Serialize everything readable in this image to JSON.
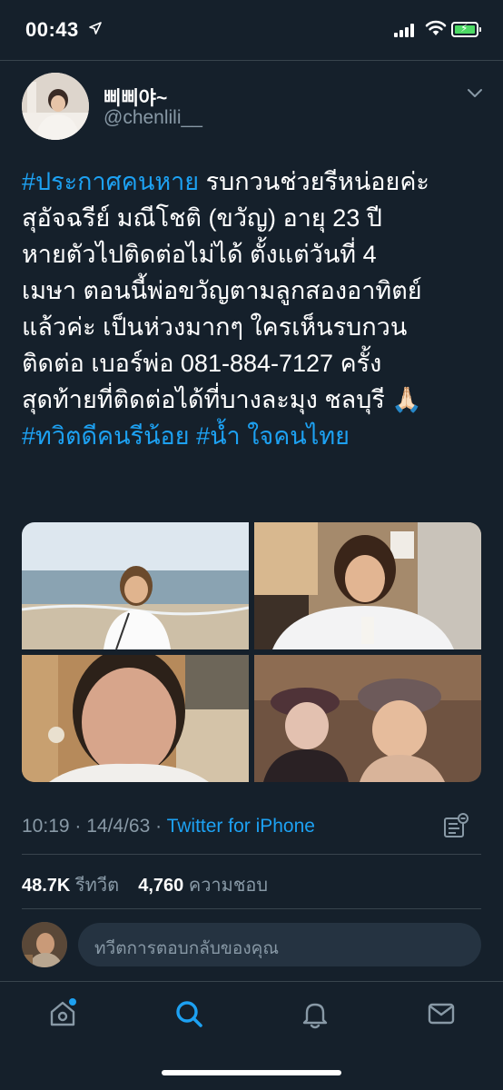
{
  "status_bar": {
    "time": "00:43",
    "location_icon": "location-arrow-icon",
    "signal_icon": "cellular-signal-icon",
    "wifi_icon": "wifi-icon",
    "battery_icon": "battery-charging-icon",
    "battery_color": "#4cd964"
  },
  "tweet": {
    "author": {
      "display_name": "삐삐야~",
      "handle": "@chenlili__"
    },
    "menu_icon": "chevron-down-icon",
    "lines": [
      [
        {
          "t": "#ประกาศคนหาย",
          "tag": true
        },
        {
          "t": " รบกวนช่วยรีหน่อยค่ะ",
          "tag": false
        }
      ],
      [
        {
          "t": "สุอัจฉรีย์ มณีโชติ (ขวัญ) อายุ 23 ปี",
          "tag": false
        }
      ],
      [
        {
          "t": "หายตัวไปติดต่อไม่ได้ ตั้งแต่วันที่ 4",
          "tag": false
        }
      ],
      [
        {
          "t": "เมษา ตอนนี้พ่อขวัญตามลูกสองอาทิตย์",
          "tag": false
        }
      ],
      [
        {
          "t": "แล้วค่ะ เป็นห่วงมากๆ  ใครเห็นรบกวน",
          "tag": false
        }
      ],
      [
        {
          "t": "ติดต่อ เบอร์พ่อ 081-884-7127 ครั้ง",
          "tag": false
        }
      ],
      [
        {
          "t": "สุดท้ายที่ติดต่อได้ที่บางละมุง ชลบุรี 🙏🏻",
          "tag": false
        }
      ],
      [
        {
          "t": "#ทวิตดีคนรีน้อย",
          "tag": true
        },
        {
          "t": " ",
          "tag": false
        },
        {
          "t": "#น้ำ ใจคนไทย",
          "tag": true
        }
      ]
    ],
    "timestamp": "10:19 · 14/4/63 · ",
    "source": "Twitter for iPhone",
    "analytics_icon": "analytics-icon",
    "retweets_count": "48.7K",
    "retweets_label": " รีทวีต",
    "likes_count": "4,760",
    "likes_label": " ความชอบ"
  },
  "reply": {
    "placeholder": "ทวีตการตอบกลับของคุณ"
  },
  "tabbar": {
    "items": [
      "home-icon",
      "search-icon",
      "notifications-icon",
      "messages-icon"
    ],
    "active": "search-icon",
    "accent": "#1da1f2",
    "inactive": "#8899a6"
  }
}
